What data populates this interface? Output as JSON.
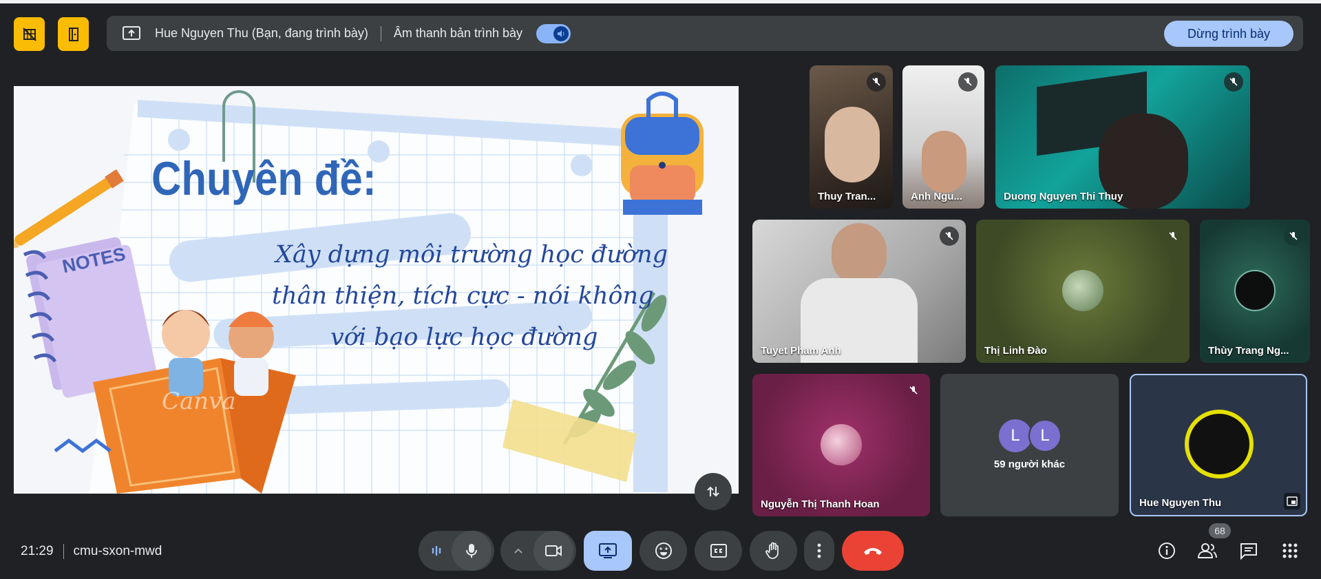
{
  "top_bar": {
    "presenter_label": "Hue Nguyen Thu (Bạn, đang trình bày)",
    "audio_label": "Âm thanh bản trình bày",
    "stop_label": "Dừng trình bày"
  },
  "slide": {
    "title": "Chuyên đề:",
    "line1": "Xây dựng môi trường học đường",
    "line2": "thân thiện, tích cực - nói không",
    "line3": "với bạo lực học đường",
    "notes_text": "NOTES",
    "watermark": "Canva"
  },
  "participants": [
    {
      "name": "Thuy Tran...",
      "muted": true
    },
    {
      "name": "Anh Ngu...",
      "muted": true
    },
    {
      "name": "Duong Nguyen Thi Thuy",
      "muted": true
    },
    {
      "name": "Tuyet Pham Anh",
      "muted": true
    },
    {
      "name": "Thị Linh Đào",
      "muted": true
    },
    {
      "name": "Thùy Trang Ng...",
      "muted": true
    },
    {
      "name": "Nguyễn Thị Thanh Hoan",
      "muted": true
    },
    {
      "name": "Hue Nguyen Thu",
      "muted": false
    }
  ],
  "others": {
    "initial_a": "L",
    "initial_b": "L",
    "label": "59 người khác"
  },
  "meeting": {
    "time": "21:29",
    "code": "cmu-sxon-mwd"
  },
  "people_count": "68",
  "colors": {
    "accent": "#a8c7fa",
    "end_call": "#ea4335",
    "amber": "#fbbc04",
    "background": "#202124"
  }
}
